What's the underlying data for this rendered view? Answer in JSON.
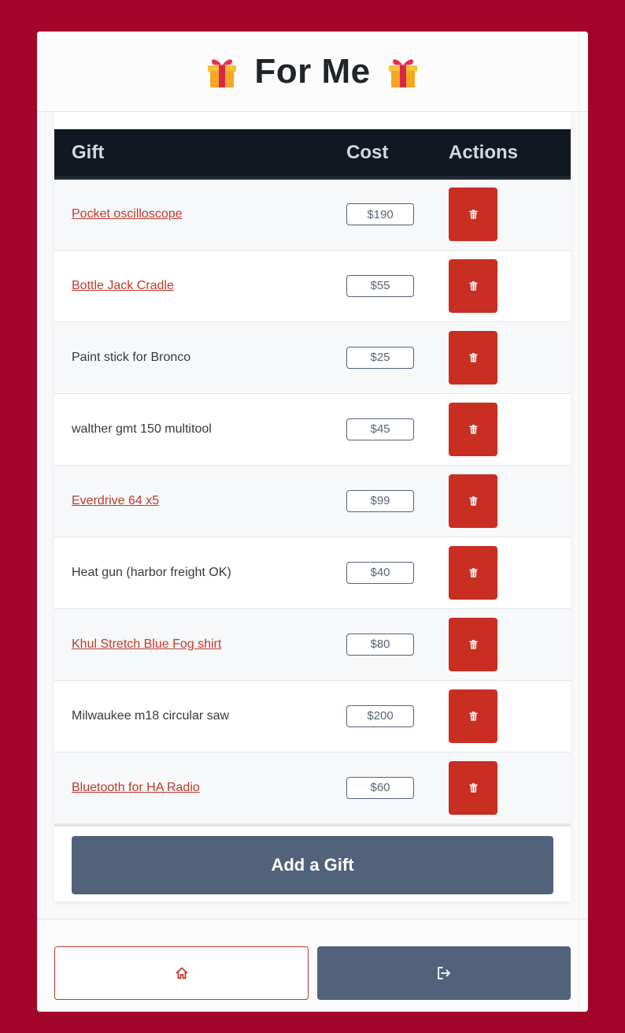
{
  "header": {
    "title": "For Me",
    "icon_left": "gift-icon",
    "icon_right": "gift-icon"
  },
  "table": {
    "columns": [
      "Gift",
      "Cost",
      "Actions"
    ],
    "rows": [
      {
        "name": "Pocket oscilloscope",
        "link": true,
        "cost": "$190"
      },
      {
        "name": "Bottle Jack Cradle",
        "link": true,
        "cost": "$55"
      },
      {
        "name": "Paint stick for Bronco",
        "link": false,
        "cost": "$25"
      },
      {
        "name": "walther gmt 150 multitool",
        "link": false,
        "cost": "$45"
      },
      {
        "name": "Everdrive 64 x5",
        "link": true,
        "cost": "$99"
      },
      {
        "name": "Heat gun (harbor freight OK)",
        "link": false,
        "cost": "$40"
      },
      {
        "name": "Khul Stretch Blue Fog shirt",
        "link": true,
        "cost": "$80"
      },
      {
        "name": "Milwaukee m18 circular saw",
        "link": false,
        "cost": "$200"
      },
      {
        "name": "Bluetooth for HA Radio",
        "link": true,
        "cost": "$60"
      }
    ],
    "delete_icon": "trash-icon"
  },
  "add_button": {
    "label": "Add a Gift"
  },
  "footer": {
    "home_icon": "home-icon",
    "logout_icon": "logout-icon"
  },
  "colors": {
    "background": "#a3062a",
    "danger": "#c92e22",
    "link": "#c0392b",
    "secondary": "#52627b",
    "table_header": "#121821"
  }
}
